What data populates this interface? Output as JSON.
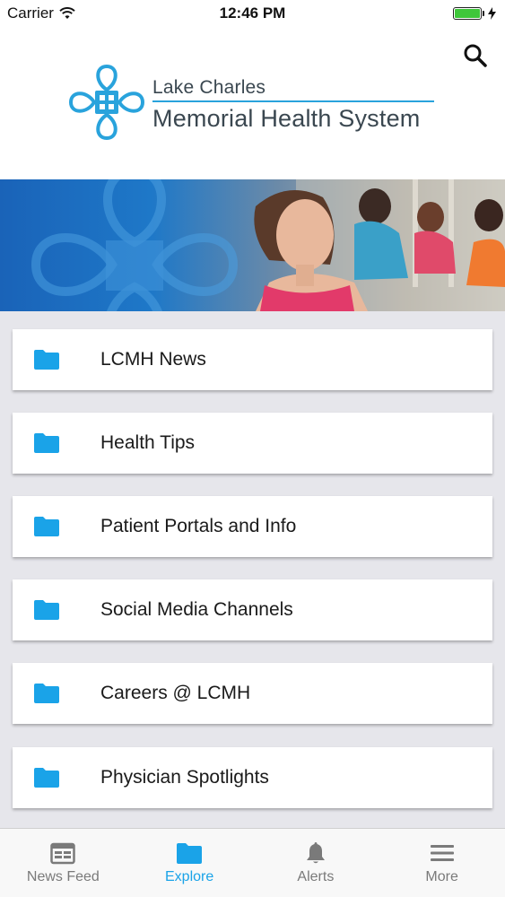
{
  "status_bar": {
    "carrier": "Carrier",
    "time": "12:46 PM",
    "wifi_icon": "wifi-icon",
    "battery_level": 1.0,
    "battery_color": "#3ec73a"
  },
  "header": {
    "search_icon": "search-icon",
    "logo": {
      "line1": "Lake Charles",
      "line2": "Memorial Health System",
      "brand_color": "#29a3dc",
      "text_color": "#3a4750"
    }
  },
  "banner": {
    "description_icon": "hero-banner-image"
  },
  "menu": {
    "accent_color": "#1aa3e8",
    "items": [
      {
        "label": "LCMH News",
        "icon": "folder-icon"
      },
      {
        "label": "Health Tips",
        "icon": "folder-icon"
      },
      {
        "label": "Patient Portals and Info",
        "icon": "folder-icon"
      },
      {
        "label": "Social Media Channels",
        "icon": "folder-icon"
      },
      {
        "label": "Careers @ LCMH",
        "icon": "folder-icon"
      },
      {
        "label": "Physician Spotlights",
        "icon": "folder-icon"
      }
    ]
  },
  "tab_bar": {
    "active_color": "#1aa3e8",
    "inactive_color": "#7a7a7a",
    "tabs": [
      {
        "label": "News Feed",
        "icon": "newspaper-icon",
        "active": false
      },
      {
        "label": "Explore",
        "icon": "folder-icon",
        "active": true
      },
      {
        "label": "Alerts",
        "icon": "bell-icon",
        "active": false
      },
      {
        "label": "More",
        "icon": "menu-icon",
        "active": false
      }
    ]
  }
}
